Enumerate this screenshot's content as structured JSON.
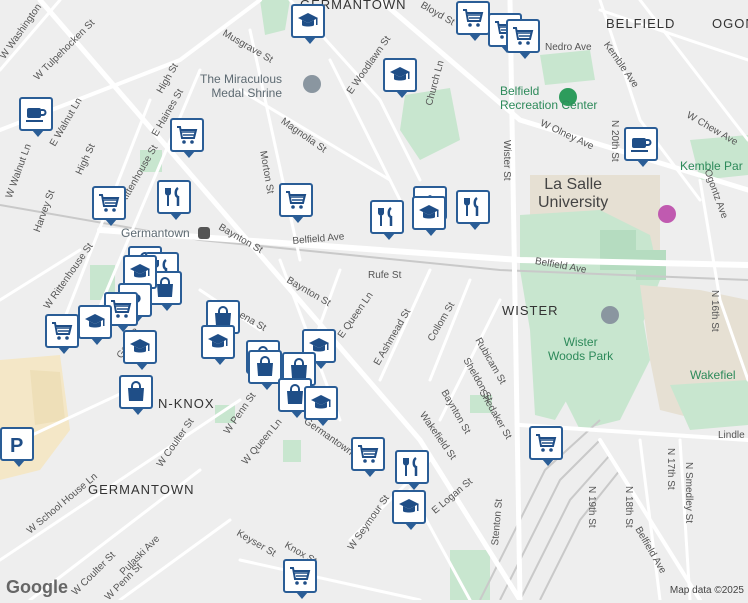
{
  "map": {
    "credit": "Map data ©2025",
    "logo": "Google"
  },
  "areas": [
    {
      "id": "germantown-top",
      "text": "GERMANTOWN"
    },
    {
      "id": "belfield",
      "text": "BELFIELD"
    },
    {
      "id": "ogontz",
      "text": "OGONTZ"
    },
    {
      "id": "wister",
      "text": "WISTER"
    },
    {
      "id": "penn-knox",
      "text": "N-KNOX"
    },
    {
      "id": "germantown-bottom",
      "text": "GERMANTOWN"
    }
  ],
  "pois": [
    {
      "id": "medal-shrine",
      "text": "The Miraculous\nMedal Shrine"
    },
    {
      "id": "belfield-rec",
      "text": "Belfield\nRecreation Center"
    },
    {
      "id": "la-salle",
      "text": "La Salle\nUniversity"
    },
    {
      "id": "wister-woods",
      "text": "Wister\nWoods Park"
    },
    {
      "id": "germantown-station",
      "text": "Germantown"
    },
    {
      "id": "kemble-park",
      "text": "Kemble Par"
    },
    {
      "id": "wakefield",
      "text": "Wakefiel"
    }
  ],
  "streets": [
    {
      "id": "musgrave",
      "text": "Musgrave St"
    },
    {
      "id": "bloyd",
      "text": "Bloyd St"
    },
    {
      "id": "w-washington",
      "text": "W Washington"
    },
    {
      "id": "w-tulpehocken",
      "text": "W Tulpehocken St"
    },
    {
      "id": "high-st-top",
      "text": "High St"
    },
    {
      "id": "e-haines",
      "text": "E Haines St"
    },
    {
      "id": "e-woodlawn",
      "text": "E Woodlawn St"
    },
    {
      "id": "church-ln",
      "text": "Church Ln"
    },
    {
      "id": "magnolia",
      "text": "Magnolia St"
    },
    {
      "id": "morton",
      "text": "Morton St"
    },
    {
      "id": "w-walnut-ln",
      "text": "W Walnut Ln"
    },
    {
      "id": "e-walnut-ln",
      "text": "E Walnut Ln"
    },
    {
      "id": "high-st-mid",
      "text": "High St"
    },
    {
      "id": "harvey",
      "text": "Harvey St"
    },
    {
      "id": "w-rittenhouse",
      "text": "W Rittenhouse St"
    },
    {
      "id": "bayton-1",
      "text": "Baynton St"
    },
    {
      "id": "belfield-ave",
      "text": "Belfield Ave"
    },
    {
      "id": "rufe",
      "text": "Rufe St"
    },
    {
      "id": "bayton-2",
      "text": "Baynton St"
    },
    {
      "id": "lena",
      "text": "Lena St"
    },
    {
      "id": "e-queen",
      "text": "E Queen Ln"
    },
    {
      "id": "e-ashmead",
      "text": "E Ashmead St"
    },
    {
      "id": "collom",
      "text": "Collom St"
    },
    {
      "id": "wister-st",
      "text": "Wister St"
    },
    {
      "id": "belfield-ave-2",
      "text": "Belfield Ave"
    },
    {
      "id": "w-olney",
      "text": "W Olney Ave"
    },
    {
      "id": "nedro",
      "text": "Nedro Ave"
    },
    {
      "id": "kemble",
      "text": "Kemble Ave"
    },
    {
      "id": "n-20th",
      "text": "N 20th St"
    },
    {
      "id": "w-chew",
      "text": "W Chew Ave"
    },
    {
      "id": "ogontz-ave",
      "text": "Ogontz Ave"
    },
    {
      "id": "n-16th",
      "text": "N 16th St"
    },
    {
      "id": "rubicam",
      "text": "Rubicam St"
    },
    {
      "id": "sheldon",
      "text": "Sheldon St"
    },
    {
      "id": "shedaker",
      "text": "Shedaker St"
    },
    {
      "id": "bayton-3",
      "text": "Baynton St"
    },
    {
      "id": "wakefield-st",
      "text": "Wakefield St"
    },
    {
      "id": "w-penn",
      "text": "W Penn St"
    },
    {
      "id": "w-queen",
      "text": "W Queen Ln"
    },
    {
      "id": "w-coulter",
      "text": "W Coulter St"
    },
    {
      "id": "w-school-house",
      "text": "W School House Ln"
    },
    {
      "id": "e-logan",
      "text": "E Logan St"
    },
    {
      "id": "w-seymour",
      "text": "W Seymour St"
    },
    {
      "id": "keyser",
      "text": "Keyser St"
    },
    {
      "id": "knox",
      "text": "Knox St"
    },
    {
      "id": "w-coulter-2",
      "text": "W Coulter St"
    },
    {
      "id": "w-penn-2",
      "text": "W Penn St"
    },
    {
      "id": "pulaski",
      "text": "Pulaski Ave"
    },
    {
      "id": "n-19th",
      "text": "N 19th St"
    },
    {
      "id": "n-18th",
      "text": "N 18th St"
    },
    {
      "id": "n-17th",
      "text": "N 17th St"
    },
    {
      "id": "n-smedley",
      "text": "N Smedley St"
    },
    {
      "id": "lindley",
      "text": "Lindle"
    },
    {
      "id": "belfield-ave-3",
      "text": "Belfield Ave"
    },
    {
      "id": "germantown-ave",
      "text": "Germantown"
    },
    {
      "id": "rittenhouse-2",
      "text": "Rittenhouse St"
    },
    {
      "id": "greene",
      "text": "Greene"
    },
    {
      "id": "stenton",
      "text": "Stenton St"
    }
  ],
  "markers": [
    {
      "id": "m1",
      "icon": "school-icon"
    },
    {
      "id": "m2",
      "icon": "grocery-cart-icon"
    },
    {
      "id": "m3",
      "icon": "grocery-cart-icon"
    },
    {
      "id": "m4",
      "icon": "grocery-cart-icon"
    },
    {
      "id": "m5",
      "icon": "school-icon"
    },
    {
      "id": "m6",
      "icon": "cafe-icon"
    },
    {
      "id": "m7",
      "icon": "grocery-cart-icon"
    },
    {
      "id": "m8",
      "icon": "cafe-icon"
    },
    {
      "id": "m9",
      "icon": "grocery-cart-icon"
    },
    {
      "id": "m10",
      "icon": "restaurant-icon"
    },
    {
      "id": "m11",
      "icon": "grocery-cart-icon"
    },
    {
      "id": "m12",
      "icon": "restaurant-icon"
    },
    {
      "id": "m13",
      "icon": "school-icon"
    },
    {
      "id": "m14",
      "icon": "restaurant-icon"
    },
    {
      "id": "m15",
      "icon": "school-icon"
    },
    {
      "id": "m16",
      "icon": "shopping-bag-icon"
    },
    {
      "id": "m17",
      "icon": "restaurant-icon"
    },
    {
      "id": "m18",
      "icon": "shopping-bag-icon"
    },
    {
      "id": "m19",
      "icon": "school-icon"
    },
    {
      "id": "m20",
      "icon": "grocery-cart-icon"
    },
    {
      "id": "m21",
      "icon": "parking-icon"
    },
    {
      "id": "m22",
      "icon": "grocery-cart-icon"
    },
    {
      "id": "m23",
      "icon": "school-icon"
    },
    {
      "id": "m24",
      "icon": "shopping-bag-icon"
    },
    {
      "id": "m25",
      "icon": "school-icon"
    },
    {
      "id": "m26",
      "icon": "school-icon"
    },
    {
      "id": "m27",
      "icon": "shopping-bag-icon"
    },
    {
      "id": "m28",
      "icon": "shopping-bag-icon"
    },
    {
      "id": "m29",
      "icon": "school-icon"
    },
    {
      "id": "m30",
      "icon": "shopping-bag-icon"
    },
    {
      "id": "m31",
      "icon": "shopping-bag-icon"
    },
    {
      "id": "m32",
      "icon": "shopping-bag-icon"
    },
    {
      "id": "m33",
      "icon": "grocery-cart-icon"
    },
    {
      "id": "m34",
      "icon": "school-icon"
    },
    {
      "id": "m35",
      "icon": "restaurant-icon"
    },
    {
      "id": "m36",
      "icon": "school-icon"
    },
    {
      "id": "m37",
      "icon": "grocery-cart-icon"
    },
    {
      "id": "m38",
      "icon": "grocery-cart-icon"
    },
    {
      "id": "m39",
      "icon": "parking-icon"
    }
  ],
  "colors": {
    "background": "#eeeeee",
    "road": "#ffffff",
    "park": "#c8e6cf",
    "campus": "#e6e0d3",
    "marker_border": "#2a5d96",
    "marker_icon": "#1f4e87"
  }
}
